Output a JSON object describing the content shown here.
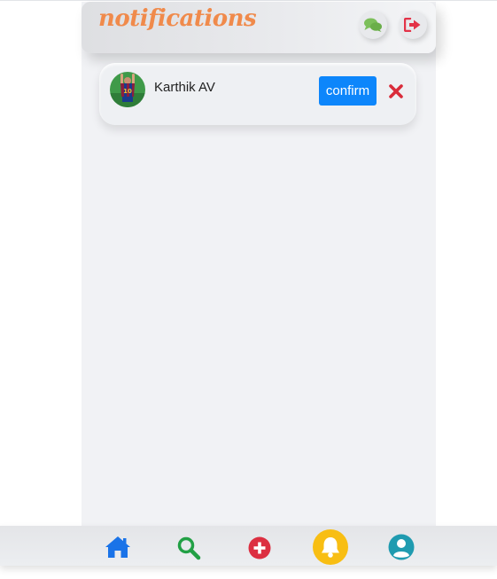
{
  "header": {
    "title": "notifications",
    "icons": [
      "chat-icon",
      "logout-icon"
    ]
  },
  "notifications": [
    {
      "name": "Karthik AV",
      "confirm_label": "confirm",
      "avatar": "avatar-photo",
      "reject_icon": "close-icon"
    }
  ],
  "bottom_nav": {
    "items": [
      "home-icon",
      "search-icon",
      "add-icon",
      "bell-icon",
      "profile-icon"
    ],
    "active": "bell-icon"
  },
  "colors": {
    "title": "#f08a4b",
    "chat": "#7cbf5a",
    "logout": "#e33348",
    "confirm": "#0d86fb",
    "reject": "#d92c3a",
    "home": "#1a73e8",
    "search": "#22a045",
    "add": "#dc2f41",
    "bell_bg": "#f8be13",
    "profile": "#1f9bb0"
  }
}
